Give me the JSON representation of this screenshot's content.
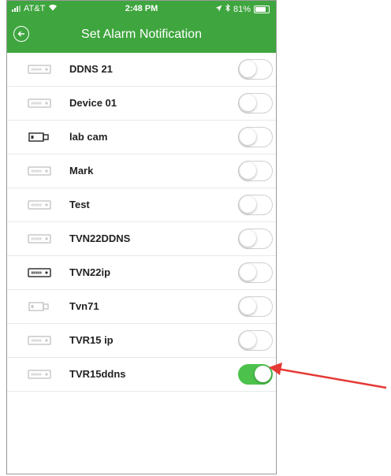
{
  "status_bar": {
    "carrier": "AT&T",
    "time": "2:48 PM",
    "battery": "81%"
  },
  "header": {
    "title": "Set Alarm Notification",
    "back_icon": "back-arrow-circle-icon"
  },
  "colors": {
    "accent": "#3fa53f",
    "toggle_on": "#4cc24c",
    "annotation_arrow": "#e53935"
  },
  "devices": [
    {
      "name": "DDNS 21",
      "icon": "dvr-icon",
      "online": false,
      "enabled": false
    },
    {
      "name": "Device 01",
      "icon": "dvr-icon",
      "online": false,
      "enabled": false
    },
    {
      "name": "lab cam",
      "icon": "camera-icon",
      "online": true,
      "enabled": false
    },
    {
      "name": "Mark",
      "icon": "dvr-icon",
      "online": false,
      "enabled": false
    },
    {
      "name": "Test",
      "icon": "dvr-icon",
      "online": false,
      "enabled": false
    },
    {
      "name": "TVN22DDNS",
      "icon": "dvr-icon",
      "online": false,
      "enabled": false
    },
    {
      "name": "TVN22ip",
      "icon": "dvr-icon",
      "online": true,
      "enabled": false
    },
    {
      "name": "Tvn71",
      "icon": "camera-icon",
      "online": false,
      "enabled": false
    },
    {
      "name": "TVR15 ip",
      "icon": "dvr-icon",
      "online": false,
      "enabled": false
    },
    {
      "name": "TVR15ddns",
      "icon": "dvr-icon",
      "online": false,
      "enabled": true
    }
  ]
}
